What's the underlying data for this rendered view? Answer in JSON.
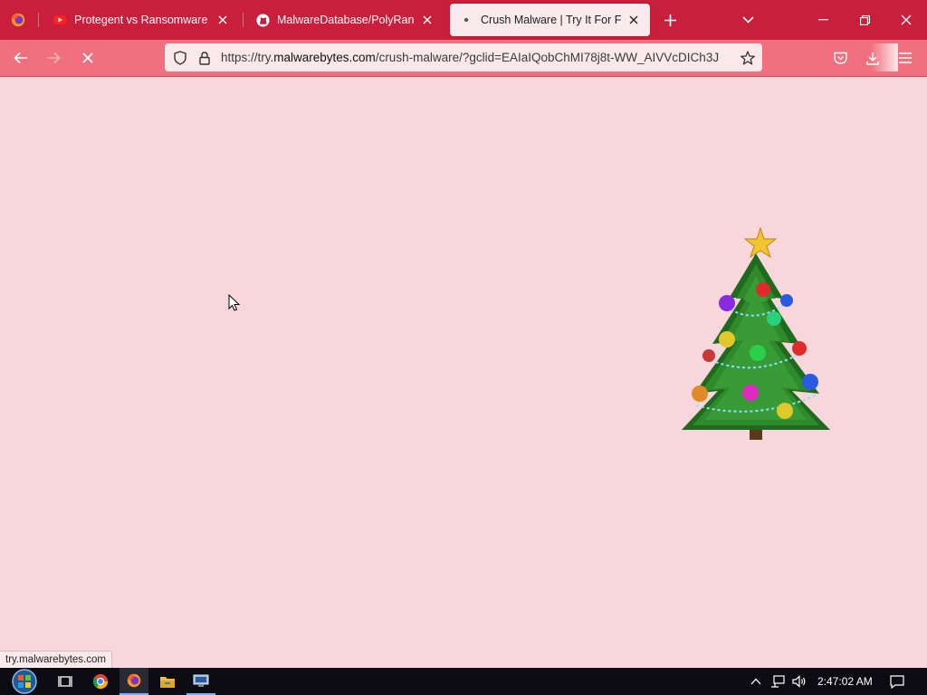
{
  "browser": {
    "tabs": [
      {
        "title": "Protegent vs Ransomware - You",
        "favicon": "youtube-icon",
        "active": false
      },
      {
        "title": "MalwareDatabase/PolyRansom",
        "favicon": "github-icon",
        "active": false
      },
      {
        "title": "Crush Malware | Try It For Free |",
        "favicon": "loading-dot-icon",
        "active": true
      }
    ],
    "url": {
      "prefix": "https://try.",
      "domain": "malwarebytes.com",
      "path": "/crush-malware/?gclid=EAIaIQobChMI78j8t-WW_AIVVcDICh3J"
    },
    "status_text": "try.malwarebytes.com"
  },
  "page": {
    "image": "christmas-tree",
    "background": "#f7d6dc"
  },
  "taskbar": {
    "clock": "2:47:02 AM",
    "pinned": [
      "start-orb-icon",
      "task-view-icon",
      "chrome-icon",
      "firefox-icon",
      "file-explorer-icon",
      "network-app-icon"
    ]
  },
  "colors": {
    "tabstrip": "#c91f3d",
    "navbar": "#f0707f",
    "active_tab": "#fbeaed"
  }
}
